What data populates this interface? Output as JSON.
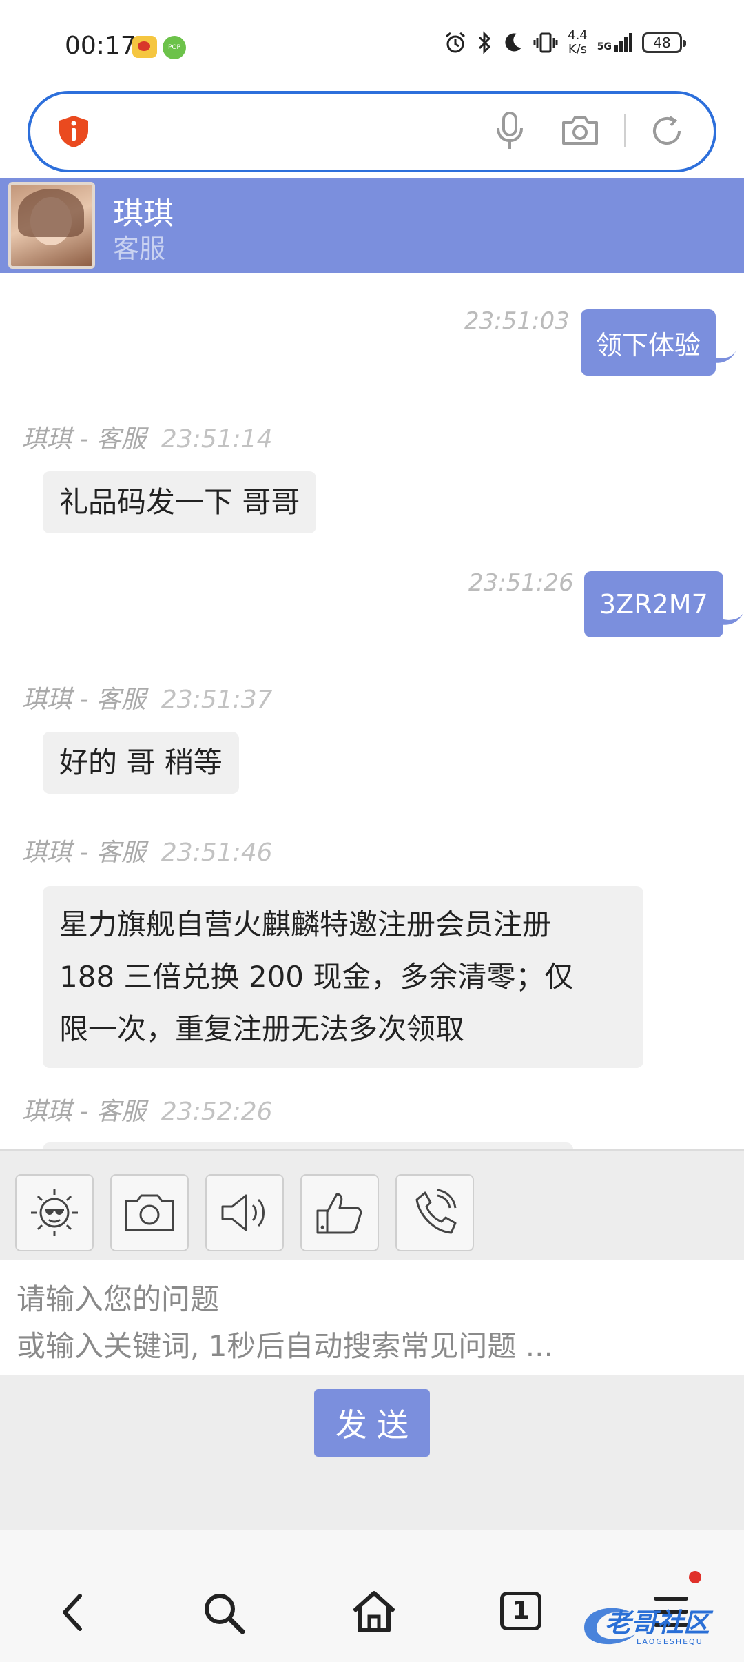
{
  "status_bar": {
    "time": "00:17",
    "net_speed_value": "4.4",
    "net_speed_unit": "K/s",
    "signal_label": "5G",
    "battery": "48"
  },
  "chat_header": {
    "name": "琪琪",
    "role": "客服"
  },
  "messages": [
    {
      "direction": "out",
      "time": "23:51:03",
      "text": "领下体验"
    },
    {
      "direction": "in",
      "sender": "琪琪 - 客服",
      "time": "23:51:14",
      "text": "礼品码发一下 哥哥"
    },
    {
      "direction": "out",
      "time": "23:51:26",
      "text": "3ZR2M7"
    },
    {
      "direction": "in",
      "sender": "琪琪 - 客服",
      "time": "23:51:37",
      "text": "好的 哥 稍等"
    },
    {
      "direction": "in",
      "sender": "琪琪 - 客服",
      "time": "23:51:46",
      "lines": [
        "星力旗舰自营火麒麟特邀注册会员注册",
        "188 三倍兑换 200 现金，多余清零；仅",
        "限一次，重复注册无法多次领取"
      ]
    },
    {
      "direction": "in",
      "sender": "琪琪 - 客服",
      "time": "23:52:26",
      "text": ""
    }
  ],
  "input": {
    "placeholder_line1": "请输入您的问题",
    "placeholder_line2": "或输入关键词, 1秒后自动搜索常见问题 ..."
  },
  "send_button": "发送",
  "bottom_nav": {
    "tab_count": "1"
  },
  "watermark": {
    "text": "老哥社区",
    "sub": "LAOGESHEQU"
  },
  "colors": {
    "accent": "#7b8fdd",
    "browser_border": "#2d6fdb"
  }
}
